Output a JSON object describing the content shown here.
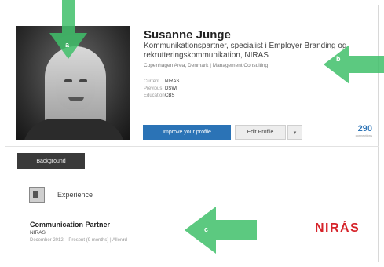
{
  "profile": {
    "name": "Susanne Junge",
    "headline": "Kommunikationspartner, specialist i Employer Branding og rekrutteringskommunikation, NIRAS",
    "location": "Copenhagen Area, Denmark  |  Management Consulting",
    "facts": [
      {
        "key": "Current",
        "value": "NIRAS"
      },
      {
        "key": "Previous",
        "value": "DSWI"
      },
      {
        "key": "Education",
        "value": "CBS"
      }
    ],
    "primary_button": "Improve your profile",
    "edit_button": "Edit Profile",
    "edit_dropdown_glyph": "▾",
    "connections_count": "290",
    "connections_label": "connections"
  },
  "tabs": {
    "background": "Background"
  },
  "experience": {
    "section_title": "Experience",
    "job_title": "Communication Partner",
    "company": "NIRAS",
    "dates": "December 2012 – Present (9 months)  |  Allerød",
    "company_logo_text": "NIRÁS"
  },
  "annotations": {
    "a": "a",
    "b": "b",
    "c": "c",
    "arrow_color": "#3fbf6a"
  }
}
